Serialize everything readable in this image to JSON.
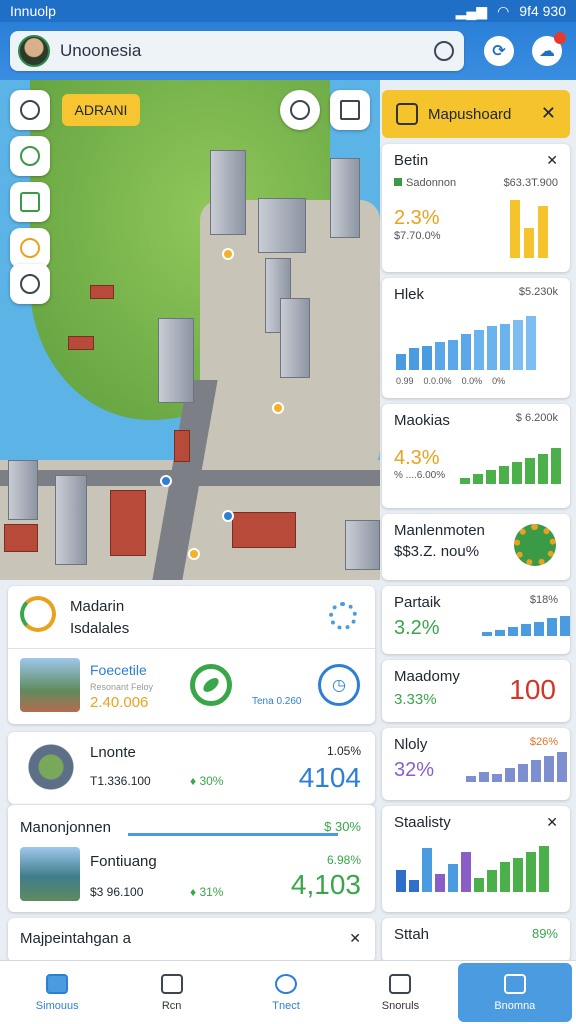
{
  "status": {
    "carrier": "Innuolp",
    "time": "9f4 930"
  },
  "header": {
    "location": "Unoonesia"
  },
  "map": {
    "chip": "ADRANI"
  },
  "maps_panel": {
    "title": "Mapushoard"
  },
  "rc1": {
    "title": "Betin",
    "legend": "Sadonnon",
    "value": "$63.3T.900",
    "pct": "2.3%",
    "sub": "$7.70.0%"
  },
  "rc2": {
    "title": "Hlek",
    "value": "$5.230k",
    "ticks": [
      "0.99",
      "0.0.0%",
      "0.0%",
      "0%"
    ]
  },
  "rc3": {
    "title": "Maokias",
    "value": "$ 6.200k",
    "pct": "4.3%",
    "sub": "% ....6.00%"
  },
  "rc4": {
    "title": "Manlenmoten",
    "value": "$$3.Z. nou%"
  },
  "rc5": {
    "title": "Partaik",
    "value": "$18%",
    "pct": "3.2%"
  },
  "rc6": {
    "title": "Maadomy",
    "pct": "3.33%",
    "num": "100"
  },
  "rc7": {
    "title": "Nloly",
    "value": "$26%",
    "pct": "32%"
  },
  "rc8": {
    "title": "Staalisty"
  },
  "rc9": {
    "title": "Sttah",
    "value": "89%"
  },
  "card1": {
    "title": "Madarin",
    "sub": "Isdalales",
    "item_title": "Foecetile",
    "item_sub": "Resonant Feloy",
    "item_value": "2.40.006",
    "item_note": "Tena 0.260"
  },
  "card2": {
    "title": "Lnonte",
    "sub": "T1.336.100",
    "pct": "♦ 30%",
    "pct_right": "1.05%",
    "num": "4104"
  },
  "card3": {
    "title": "Manonjonnen",
    "value": "$ 30%",
    "item_title": "Fontiuang",
    "item_sub": "$3 96.100",
    "pct": "♦ 31%",
    "pct_right": "6.98%",
    "num": "4,103"
  },
  "card4": {
    "title": "Majpeintahgan a"
  },
  "nav": {
    "items": [
      "Simouus",
      "Rcn",
      "Tnect",
      "Snoruls",
      "Bnomna"
    ]
  }
}
